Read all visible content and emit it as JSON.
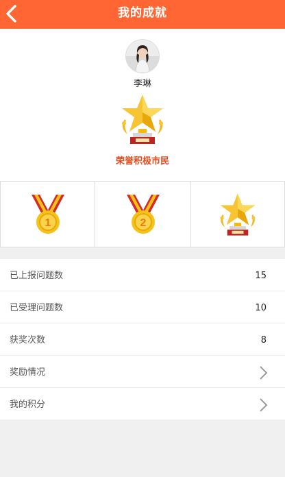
{
  "header": {
    "title": "我的成就",
    "back_icon": "chevron-left-icon"
  },
  "profile": {
    "name": "李琳",
    "badge_title": "荣誉积极市民",
    "trophy_icon": "trophy-icon"
  },
  "medals": [
    {
      "icon": "gold-medal-1-icon",
      "number": "1"
    },
    {
      "icon": "gold-medal-2-icon",
      "number": "2"
    },
    {
      "icon": "trophy-icon"
    }
  ],
  "stats": [
    {
      "label": "已上报问题数",
      "value": "15"
    },
    {
      "label": "已受理问题数",
      "value": "10"
    },
    {
      "label": "获奖次数",
      "value": "8"
    },
    {
      "label": "奖励情况",
      "icon": "chevron-right-icon"
    },
    {
      "label": "我的积分",
      "icon": "chevron-right-icon"
    }
  ],
  "colors": {
    "accent": "#ff6633",
    "badge_text": "#e64a1c",
    "gold": "#f5c218",
    "ribbon": "#d42a2a"
  }
}
